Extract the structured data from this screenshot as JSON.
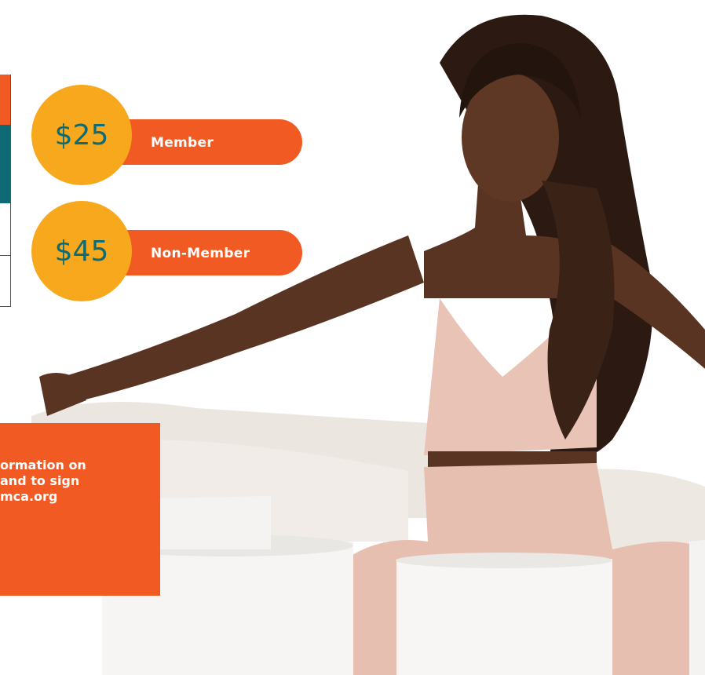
{
  "prices": [
    {
      "amount": "$25",
      "label": "Member"
    },
    {
      "amount": "$45",
      "label": "Non-Member"
    }
  ],
  "info": {
    "line1": "ormation on",
    "line2": "and to sign",
    "line3": "mca.org"
  },
  "colors": {
    "orange": "#f15a22",
    "gold": "#f7a81c",
    "teal": "#0e6b73"
  },
  "photo": {
    "subject_icon": "meditation-photo"
  }
}
